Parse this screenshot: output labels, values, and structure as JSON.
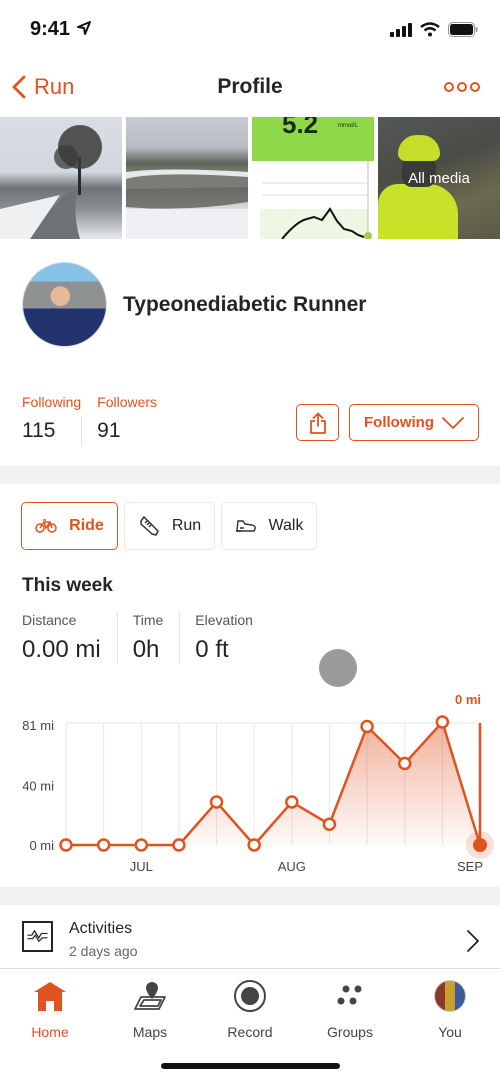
{
  "status_bar": {
    "time": "9:41"
  },
  "nav": {
    "back_label": "Run",
    "title": "Profile"
  },
  "media": {
    "glucose_value": "5.2",
    "glucose_unit": "mmol/L",
    "all_media_label": "All media"
  },
  "profile": {
    "name": "Typeonediabetic Runner",
    "following_label": "Following",
    "following_count": "115",
    "followers_label": "Followers",
    "followers_count": "91",
    "follow_button_label": "Following"
  },
  "sport_tabs": [
    {
      "label": "Ride",
      "icon": "bike-icon",
      "active": true
    },
    {
      "label": "Run",
      "icon": "shoe-icon",
      "active": false
    },
    {
      "label": "Walk",
      "icon": "walk-shoe-icon",
      "active": false
    }
  ],
  "this_week": {
    "title": "This week",
    "stats": [
      {
        "label": "Distance",
        "value": "0.00 mi"
      },
      {
        "label": "Time",
        "value": "0h"
      },
      {
        "label": "Elevation",
        "value": "0 ft"
      }
    ]
  },
  "chart_data": {
    "type": "area",
    "title": "",
    "xlabel": "",
    "ylabel": "",
    "unit": "mi",
    "ylim": [
      0,
      81
    ],
    "y_ticks": [
      {
        "value": 0,
        "label": "0 mi"
      },
      {
        "value": 40,
        "label": "40 mi"
      },
      {
        "value": 81,
        "label": "81 mi"
      }
    ],
    "x_tick_labels": [
      {
        "index": 2,
        "label": "JUL"
      },
      {
        "index": 6,
        "label": "AUG"
      },
      {
        "index": 11,
        "label": "SEP"
      }
    ],
    "values": [
      0,
      0,
      0,
      0,
      29,
      0,
      29,
      14,
      80,
      55,
      83,
      0
    ],
    "selected_index": 11,
    "selected_label": "0 mi",
    "grid": true,
    "color": "#e0531f"
  },
  "activities": {
    "title": "Activities",
    "subtitle": "2 days ago"
  },
  "tabbar": [
    {
      "label": "Home",
      "active": true
    },
    {
      "label": "Maps",
      "active": false
    },
    {
      "label": "Record",
      "active": false
    },
    {
      "label": "Groups",
      "active": false
    },
    {
      "label": "You",
      "active": false
    }
  ]
}
